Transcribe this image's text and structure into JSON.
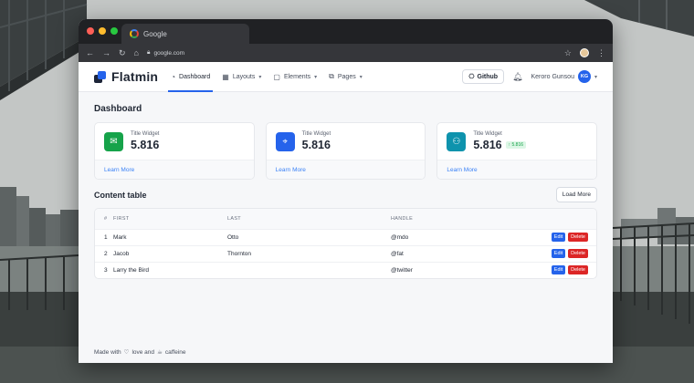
{
  "browser": {
    "tab_title": "Google",
    "url": "google.com"
  },
  "app": {
    "brand": "Flatmin",
    "menu": [
      {
        "label": "Dashboard",
        "icon": "gauge-icon"
      },
      {
        "label": "Layouts",
        "icon": "layout-icon"
      },
      {
        "label": "Elements",
        "icon": "elements-icon"
      },
      {
        "label": "Pages",
        "icon": "pages-icon"
      }
    ],
    "github_label": "Github",
    "user_name": "Keroro Gunsou",
    "user_initials": "KG"
  },
  "dashboard": {
    "title": "Dashboard",
    "widgets": [
      {
        "title": "Title Widget",
        "value": "5.816",
        "link": "Learn More",
        "icon": "envelope-open-icon",
        "color": "#16a34a"
      },
      {
        "title": "Title Widget",
        "value": "5.816",
        "link": "Learn More",
        "icon": "pointer-click-icon",
        "color": "#2563eb"
      },
      {
        "title": "Title Widget",
        "value": "5.816",
        "link": "Learn More",
        "icon": "users-icon",
        "color": "#0e93ad",
        "trend": "5.816"
      }
    ]
  },
  "table": {
    "title": "Content table",
    "load_more": "Load More",
    "columns": [
      "#",
      "FIRST",
      "LAST",
      "HANDLE"
    ],
    "rows": [
      {
        "num": "1",
        "first": "Mark",
        "last": "Otto",
        "handle": "@mdo"
      },
      {
        "num": "2",
        "first": "Jacob",
        "last": "Thornton",
        "handle": "@fat"
      },
      {
        "num": "3",
        "first": "Larry the Bird",
        "last": "",
        "handle": "@twitter"
      }
    ],
    "edit_label": "Edit",
    "delete_label": "Delete"
  },
  "footer": {
    "prefix": "Made with",
    "middle": "love and",
    "suffix": "caffeine"
  },
  "colors": {
    "accent": "#2563eb",
    "success": "#16a34a",
    "danger": "#dc2626",
    "info": "#0e93ad"
  }
}
